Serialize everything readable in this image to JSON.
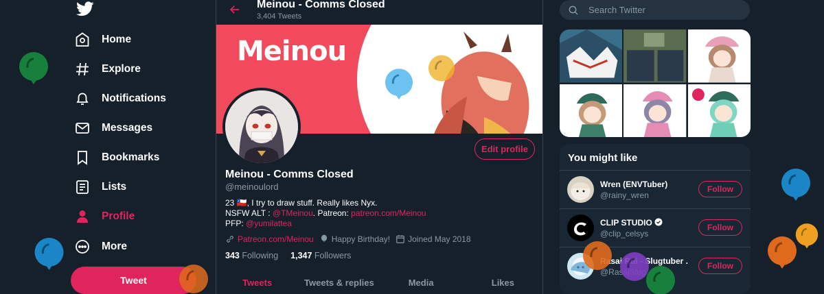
{
  "nav": {
    "items": [
      {
        "label": "Home",
        "icon": "home-icon"
      },
      {
        "label": "Explore",
        "icon": "hashtag-icon"
      },
      {
        "label": "Notifications",
        "icon": "bell-icon"
      },
      {
        "label": "Messages",
        "icon": "envelope-icon"
      },
      {
        "label": "Bookmarks",
        "icon": "bookmark-icon"
      },
      {
        "label": "Lists",
        "icon": "list-icon"
      },
      {
        "label": "Profile",
        "icon": "profile-icon",
        "active": true
      },
      {
        "label": "More",
        "icon": "more-icon"
      }
    ],
    "tweet_label": "Tweet"
  },
  "header": {
    "title": "Meinou - Comms Closed",
    "subtitle": "3,404 Tweets"
  },
  "banner": {
    "word": "Meinou"
  },
  "profile": {
    "edit_label": "Edit profile",
    "name": "Meinou - Comms Closed",
    "handle": "@meinoulord",
    "bio_line1": "23 🇨🇱, I try to draw stuff.   Really likes Nyx.",
    "bio_nsfw_prefix": "NSFW ALT : ",
    "bio_nsfw_link": "@TMeinou",
    "bio_patreon_prefix": ".   Patreon: ",
    "bio_patreon_link": "patreon.com/Meinou",
    "bio_pfp_prefix": "PFP: ",
    "bio_pfp_link": "@yumilattea",
    "website": "Patreon.com/Meinou",
    "birthday": "Happy Birthday!",
    "joined": "Joined May 2018",
    "following_count": "343",
    "following_label": "Following",
    "followers_count": "1,347",
    "followers_label": "Followers"
  },
  "tabs": [
    "Tweets",
    "Tweets & replies",
    "Media",
    "Likes"
  ],
  "search": {
    "placeholder": "Search Twitter"
  },
  "suggestions": {
    "title": "You might like",
    "follow_label": "Follow",
    "items": [
      {
        "name": "Wren (ENVTuber)",
        "handle": "@rainy_wren"
      },
      {
        "name": "CLIP STUDIO",
        "handle": "@clip_celsys"
      },
      {
        "name": "Rasai Rui - Slugtuber .",
        "handle": "@RasaiSlug"
      }
    ]
  },
  "colors": {
    "accent": "#e0245e",
    "background": "#15202b",
    "secondary_text": "#8899a6"
  }
}
